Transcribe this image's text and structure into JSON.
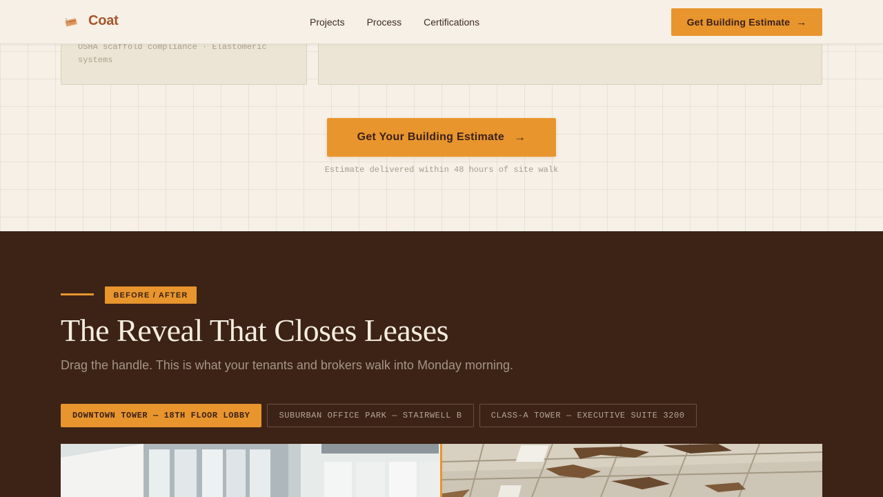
{
  "header": {
    "brand": "Coat",
    "nav": [
      "Projects",
      "Process",
      "Certifications"
    ],
    "cta_label": "Get Building Estimate",
    "cta_arrow": "→"
  },
  "cards": {
    "left_text": "OSHA scaffold compliance · Elastomeric systems"
  },
  "cta": {
    "label": "Get Your Building Estimate",
    "arrow": "→",
    "note": "Estimate delivered within 48 hours of site walk"
  },
  "reveal": {
    "badge": "BEFORE / AFTER",
    "title": "The Reveal That Closes Leases",
    "subtitle": "Drag the handle. This is what your tenants and brokers walk into Monday morning.",
    "tabs": [
      "DOWNTOWN TOWER — 18TH FLOOR LOBBY",
      "SUBURBAN OFFICE PARK — STAIRWELL B",
      "CLASS-A TOWER — EXECUTIVE SUITE 3200"
    ],
    "active_tab": 0
  },
  "colors": {
    "accent": "#e8952e",
    "brand": "#a5552a",
    "dark_bg": "#3c2316",
    "light_bg": "#f6f0e7"
  }
}
